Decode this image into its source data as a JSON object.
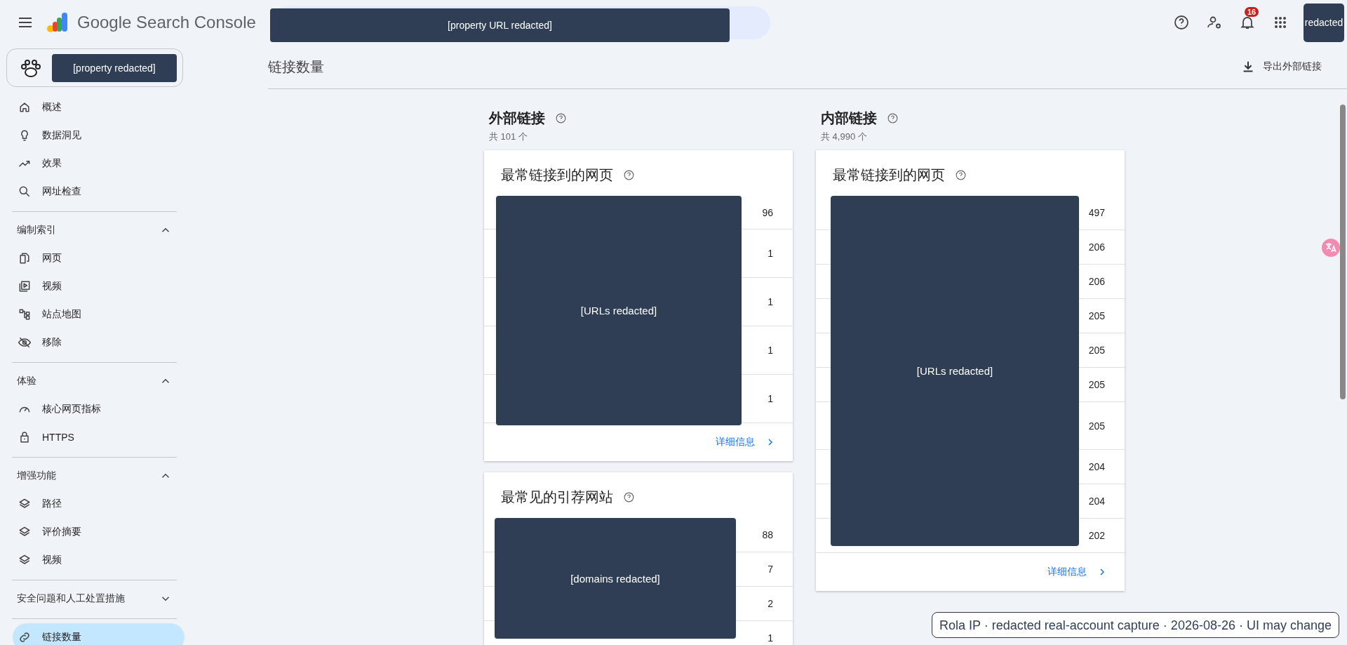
{
  "topbar": {
    "product": "Google Search Console",
    "search_redacted": "[property URL redacted]",
    "notifications": "16",
    "avatar": "redacted"
  },
  "sidebar": {
    "property": "[property redacted]",
    "sections": [
      {
        "items": [
          {
            "label": "概述",
            "selected": false
          },
          {
            "label": "数据洞见",
            "selected": false
          },
          {
            "label": "效果",
            "selected": false
          },
          {
            "label": "网址检查",
            "selected": false
          }
        ]
      },
      {
        "title": "编制索引",
        "expanded": true,
        "items": [
          {
            "label": "网页",
            "selected": false
          },
          {
            "label": "视频",
            "selected": false
          },
          {
            "label": "站点地图",
            "selected": false
          },
          {
            "label": "移除",
            "selected": false
          }
        ]
      },
      {
        "title": "体验",
        "expanded": true,
        "items": [
          {
            "label": "核心网页指标",
            "selected": false
          },
          {
            "label": "HTTPS",
            "selected": false
          }
        ]
      },
      {
        "title": "增强功能",
        "expanded": true,
        "items": [
          {
            "label": "路径",
            "selected": false
          },
          {
            "label": "评价摘要",
            "selected": false
          },
          {
            "label": "视频",
            "selected": false
          }
        ]
      },
      {
        "title": "安全问题和人工处置措施",
        "expanded": false
      },
      {
        "items": [
          {
            "label": "链接数量",
            "selected": true
          }
        ]
      }
    ]
  },
  "page": {
    "title": "链接数量",
    "export": "导出外部链接"
  },
  "columns": [
    {
      "title": "外部链接",
      "total": "共 101 个",
      "cards": [
        {
          "title": "最常链接到的网页",
          "redacted": "[URLs redacted]",
          "counts": [
            "96",
            "1",
            "1",
            "1",
            "1"
          ],
          "link": "详细信息"
        },
        {
          "title": "最常见的引荐网站",
          "redacted": "[domains redacted]",
          "counts": [
            "88",
            "7",
            "2",
            "1"
          ]
        }
      ]
    },
    {
      "title": "内部链接",
      "total": "共 4,990 个",
      "cards": [
        {
          "title": "最常链接到的网页",
          "redacted": "[URLs redacted]",
          "counts": [
            "497",
            "206",
            "206",
            "205",
            "205",
            "205",
            "205",
            "204",
            "204",
            "202"
          ],
          "link": "详细信息"
        }
      ]
    }
  ],
  "note": "Rola IP · redacted real-account capture · 2026-08-26 · UI may change"
}
